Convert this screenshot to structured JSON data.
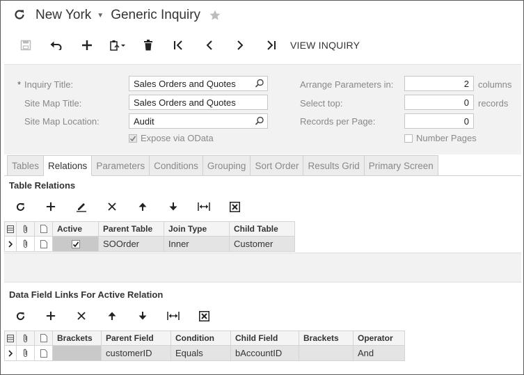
{
  "header": {
    "company": "New York",
    "screen_title": "Generic Inquiry"
  },
  "toolbar": {
    "view_inquiry": "VIEW INQUIRY"
  },
  "form": {
    "inquiry_title_label": "Inquiry Title:",
    "inquiry_title_value": "Sales Orders and Quotes",
    "site_map_title_label": "Site Map Title:",
    "site_map_title_value": "Sales Orders and Quotes",
    "site_map_location_label": "Site Map Location:",
    "site_map_location_value": "Audit",
    "expose_odata_label": "Expose via OData",
    "expose_odata_checked": true,
    "arrange_params_label": "Arrange Parameters in:",
    "arrange_params_value": "2",
    "arrange_params_unit": "columns",
    "select_top_label": "Select top:",
    "select_top_value": "0",
    "select_top_unit": "records",
    "records_per_page_label": "Records per Page:",
    "records_per_page_value": "0",
    "number_pages_label": "Number Pages",
    "number_pages_checked": false
  },
  "tabs": [
    {
      "label": "Tables",
      "active": false
    },
    {
      "label": "Relations",
      "active": true
    },
    {
      "label": "Parameters",
      "active": false
    },
    {
      "label": "Conditions",
      "active": false
    },
    {
      "label": "Grouping",
      "active": false
    },
    {
      "label": "Sort Order",
      "active": false
    },
    {
      "label": "Results Grid",
      "active": false
    },
    {
      "label": "Primary Screen",
      "active": false
    }
  ],
  "table_relations": {
    "title": "Table Relations",
    "columns": {
      "active": "Active",
      "parent_table": "Parent Table",
      "join_type": "Join Type",
      "child_table": "Child Table"
    },
    "rows": [
      {
        "active": true,
        "parent_table": "SOOrder",
        "join_type": "Inner",
        "child_table": "Customer"
      }
    ]
  },
  "data_field_links": {
    "title": "Data Field Links For Active Relation",
    "columns": {
      "brackets_open": "Brackets",
      "parent_field": "Parent Field",
      "condition": "Condition",
      "child_field": "Child Field",
      "brackets_close": "Brackets",
      "operator": "Operator"
    },
    "rows": [
      {
        "brackets_open": "",
        "parent_field": "customerID",
        "condition": "Equals",
        "child_field": "bAccountID",
        "brackets_close": "",
        "operator": "And"
      }
    ]
  }
}
